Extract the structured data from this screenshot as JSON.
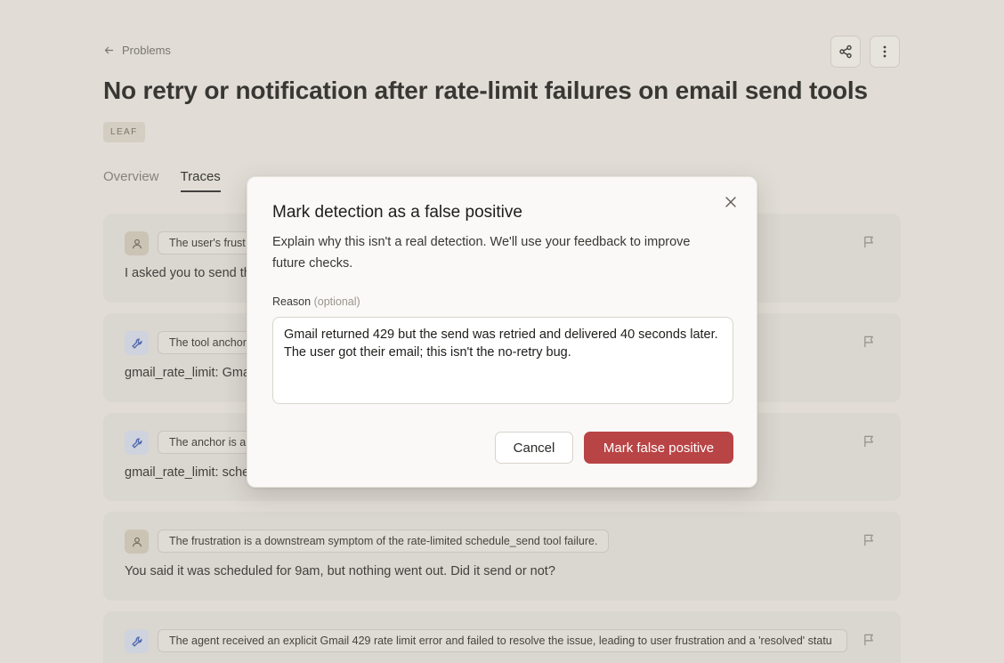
{
  "header": {
    "back_label": "Problems",
    "title": "No retry or notification after rate-limit failures on email send tools",
    "badge": "LEAF"
  },
  "tabs": [
    {
      "label": "Overview",
      "active": false
    },
    {
      "label": "Traces",
      "active": true
    }
  ],
  "traces": [
    {
      "kind": "user",
      "chip": "The user's frust",
      "message": "I asked you to send th"
    },
    {
      "kind": "tool",
      "chip": "The tool anchor",
      "message": "gmail_rate_limit: Gma"
    },
    {
      "kind": "tool",
      "chip": "The anchor is a",
      "message": "gmail_rate_limit: sche"
    },
    {
      "kind": "user",
      "chip": "The frustration is a downstream symptom of the rate-limited schedule_send tool failure.",
      "message": "You said it was scheduled for 9am, but nothing went out. Did it send or not?"
    },
    {
      "kind": "tool",
      "chip": "The agent received an explicit Gmail 429 rate limit error and failed to resolve the issue, leading to user frustration and a 'resolved' statu",
      "message": ""
    }
  ],
  "modal": {
    "title": "Mark detection as a false positive",
    "description": "Explain why this isn't a real detection. We'll use your feedback to improve future checks.",
    "reason_label": "Reason",
    "reason_optional": "(optional)",
    "reason_value": "Gmail returned 429 but the send was retried and delivered 40 seconds later. The user got their email; this isn't the no-retry bug.",
    "cancel_label": "Cancel",
    "confirm_label": "Mark false positive"
  },
  "colors": {
    "accent_danger": "#b94445",
    "tool_avatar_bg": "#cfd4e2",
    "user_avatar_bg": "#cbc1b1"
  },
  "icons": {
    "back": "arrow-left-icon",
    "share": "share-icon",
    "more": "more-vertical-icon",
    "user": "user-icon",
    "tool": "wrench-icon",
    "flag": "flag-icon",
    "close": "close-icon"
  }
}
